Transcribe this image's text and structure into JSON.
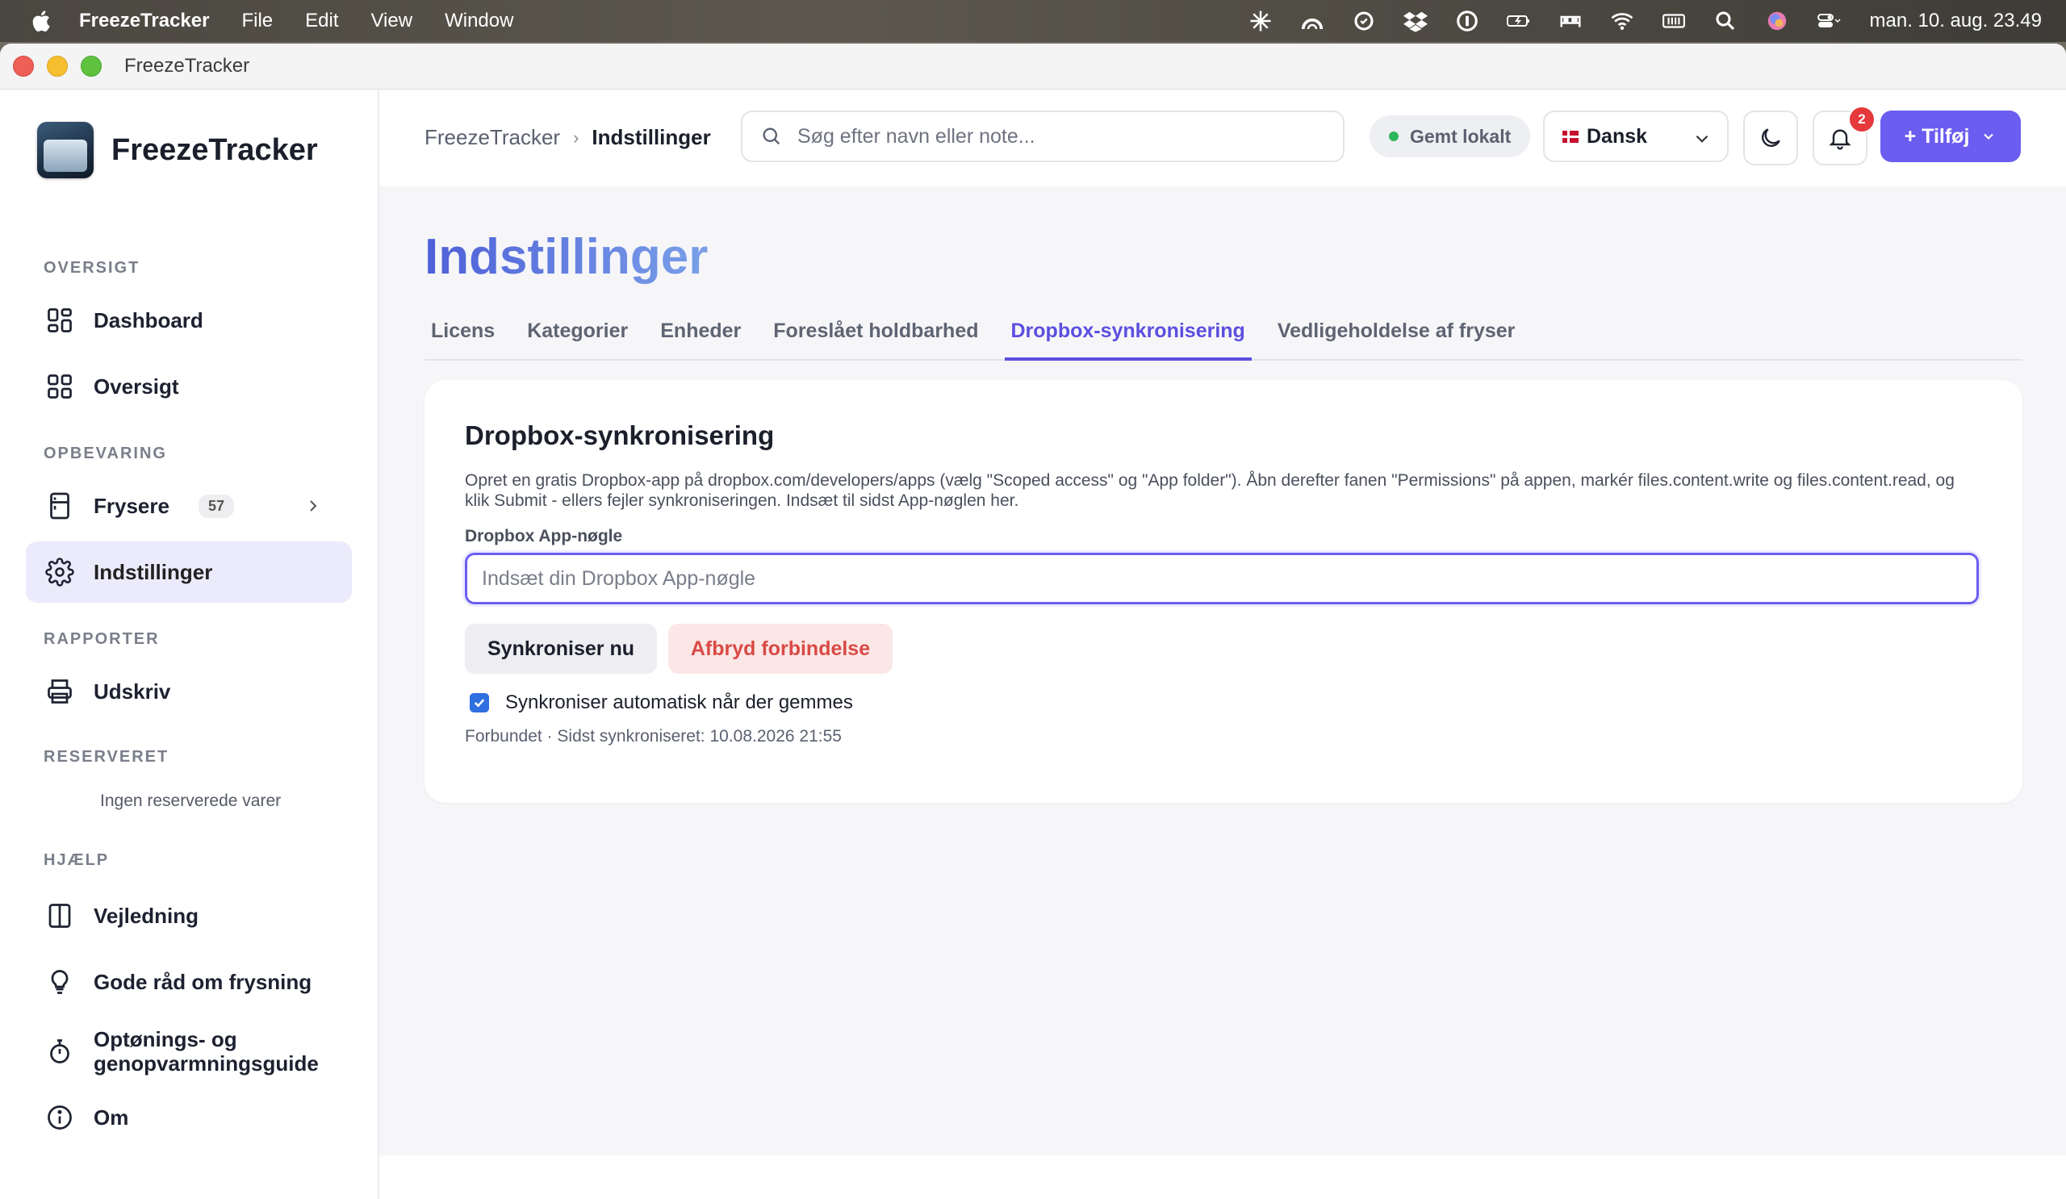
{
  "menubar": {
    "app": "FreezeTracker",
    "items": [
      "File",
      "Edit",
      "View",
      "Window"
    ],
    "clock": "man. 10. aug. 23.49"
  },
  "window": {
    "title": "FreezeTracker"
  },
  "sidebar": {
    "brand": "FreezeTracker",
    "sections": {
      "overview": "OVERSIGT",
      "storage": "OPBEVARING",
      "reports": "RAPPORTER",
      "reserved": "RESERVERET",
      "help": "HJÆLP"
    },
    "items": {
      "dashboard": "Dashboard",
      "overview": "Oversigt",
      "freezers": "Frysere",
      "freezers_count": "57",
      "settings": "Indstillinger",
      "print": "Udskriv",
      "guide": "Vejledning",
      "tips": "Gode råd om frysning",
      "thaw_line1": "Optønings- og",
      "thaw_line2": "genopvarmningsguide",
      "about": "Om"
    },
    "reserved_empty": "Ingen reserverede varer"
  },
  "header": {
    "breadcrumb": [
      "FreezeTracker",
      "Indstillinger"
    ],
    "search_placeholder": "Søg efter navn eller note...",
    "saved": "Gemt lokalt",
    "language": "Dansk",
    "notifications": "2",
    "add_button": "+ Tilføj"
  },
  "main": {
    "title": "Indstillinger",
    "tabs": [
      "Licens",
      "Kategorier",
      "Enheder",
      "Foreslået holdbarhed",
      "Dropbox-synkronisering",
      "Vedligeholdelse af fryser"
    ],
    "active_tab": "Dropbox-synkronisering",
    "card": {
      "title": "Dropbox-synkronisering",
      "description": "Opret en gratis Dropbox-app på dropbox.com/developers/apps (vælg \"Scoped access\" og \"App folder\"). Åbn derefter fanen \"Permissions\" på appen, markér files.content.write og files.content.read, og klik Submit - ellers fejler synkroniseringen. Indsæt til sidst App-nøglen her.",
      "field_label": "Dropbox App-nøgle",
      "field_placeholder": "Indsæt din Dropbox App-nøgle",
      "field_value": "",
      "sync_button": "Synkroniser nu",
      "disconnect_button": "Afbryd forbindelse",
      "auto_sync_label": "Synkroniser automatisk når der gemmes",
      "auto_sync_checked": true,
      "status": "Forbundet · Sidst synkroniseret: 10.08.2026 21:55"
    }
  },
  "colors": {
    "accent": "#6b5df0",
    "danger": "#d94a45",
    "success": "#2fb65b",
    "badge": "#e5393b"
  }
}
